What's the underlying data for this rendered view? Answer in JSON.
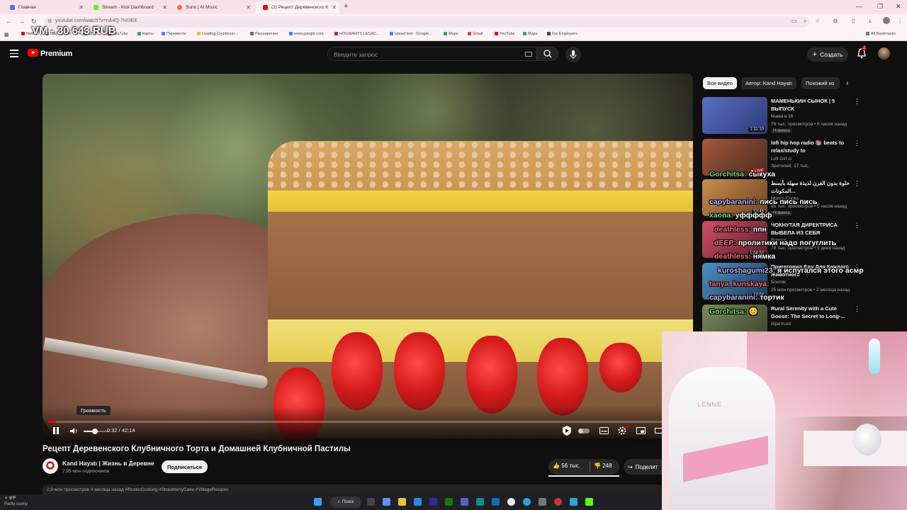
{
  "browser": {
    "tabs": [
      {
        "label": "Главная",
        "color": "#4a7cf0"
      },
      {
        "label": "Stream - Kick Dashboard",
        "color": "#53fc18"
      },
      {
        "label": "Suno | AI Music",
        "color": "#ff6a3d"
      },
      {
        "label": "(2) Рецепт Деревенского К",
        "color": "#ff0000"
      }
    ],
    "url": "youtube.com/watch?v=nA4Q-7HI3EE",
    "bookmarks": [
      "Netflix",
      "Gazzet.com",
      "Chat",
      "YouTube",
      "Карты",
      "Перевести",
      "Leading Cryptocurr...",
      "Расширения",
      "www.google.com",
      "HOGWARTS LEGAC...",
      "speed test - Google...",
      "Maps",
      "Gmail",
      "YouTube",
      "Maps",
      "For Employers"
    ],
    "all_bookmarks": "All Bookmarks"
  },
  "overlay_balance": "VM - 30 643 RUB",
  "youtube": {
    "brand": "Premium",
    "search_placeholder": "Введите запрос",
    "create_label": "Создать",
    "notif_count": "2"
  },
  "player": {
    "volume_tooltip": "Громкость",
    "current_time": "0:32",
    "duration": "42:14",
    "timecode": "0:32 / 42:14",
    "progress_fraction": 0.013,
    "volume_fraction": 0.45
  },
  "video": {
    "title": "Рецепт Деревенского Клубничного Торта и Домашней Клубничной Пастилы",
    "channel": "Kand Hayatı | Жизнь в Деревне",
    "subscribers": "7,95 млн подписчиков",
    "subscribe_label": "Подписаться",
    "likes": "56 тыс.",
    "dislikes": "248",
    "like_fraction": 0.995,
    "share_label": "Поделит",
    "description_peek": "2,9 млн просмотров  4 месяца назад  #RusticCooking #StrawberryCake #VillageRecipes"
  },
  "chips": [
    "Все видео",
    "Автор: Kand Hayatı",
    "Похожий ко"
  ],
  "recommendations": [
    {
      "title": "МАМЕНЬКИН СЫНОК | 5 ВЫПУСК",
      "channel": "Мама в 16",
      "meta": "79 тыс. просмотров • 6 часов назад",
      "badge": "Новинка",
      "duration": "1:11:10",
      "thumb_color": "#5b6ec2"
    },
    {
      "title": "lofi hip hop radio 📚 beats to relax/study to",
      "channel": "Lofi Girl ⊙",
      "meta": "Зрителей: 17 тыс.",
      "badge": "",
      "duration": "",
      "thumb_color": "#a45a3a"
    },
    {
      "title": "حلوة بدون الفرن لذيذة سهلة بأبسط المكونات...",
      "channel": "Mom's Cooks",
      "meta": "85 тыс. просмотров • 5 часов назад",
      "badge": "Новинка",
      "duration": "10:46",
      "thumb_color": "#c88e4e"
    },
    {
      "title": "ЧОКНУТАЯ ДИРЕКТРИСА ВЫБЕЛА ИЗ СЕБЯ КЛИЕНТО...",
      "channel": "Вопрос",
      "meta": "79 тыс. просмотров • 5 дней назад",
      "badge": "",
      "duration": "1:04:53",
      "thumb_color": "#d04e66"
    },
    {
      "title": "Приготовил Еду Для Каждого Животного",
      "channel": "Бонтик",
      "meta": "25 млн просмотров • 2 месяца назад",
      "badge": "",
      "duration": "24:04",
      "thumb_color": "#4f8fc0"
    },
    {
      "title": "Rural Serenity with a Cute Goose: The Secret to Long-...",
      "channel": "Bijar Kool",
      "meta": "",
      "badge": "",
      "duration": "",
      "thumb_color": "#7a8a5e"
    }
  ],
  "chat": [
    {
      "nick": "Gorchitsa:",
      "msg": "сыкуха"
    },
    {
      "nick": "capybaranini:",
      "msg": "пись пись пись"
    },
    {
      "nick": "xaona:",
      "msg": "уффффф"
    },
    {
      "nick": "deathless:",
      "msg": "ппн"
    },
    {
      "nick": "dEEP:",
      "msg": "пролитики надо погуглить"
    },
    {
      "nick": "deathless:",
      "msg": "нямка"
    },
    {
      "nick": "kuroshagumi23:",
      "msg": "я испугался этого асмр"
    },
    {
      "nick": "tanya_kunskaya:",
      "msg": ""
    },
    {
      "nick": "capybaranini:",
      "msg": "тортик"
    },
    {
      "nick": "Gorchitsa:",
      "msg": "😊"
    }
  ],
  "webcam": {
    "chair_brand": "LENNE"
  },
  "taskbar": {
    "weather_temp": "9°F",
    "weather_desc": "Partly sunny",
    "search_label": "Поиск"
  }
}
